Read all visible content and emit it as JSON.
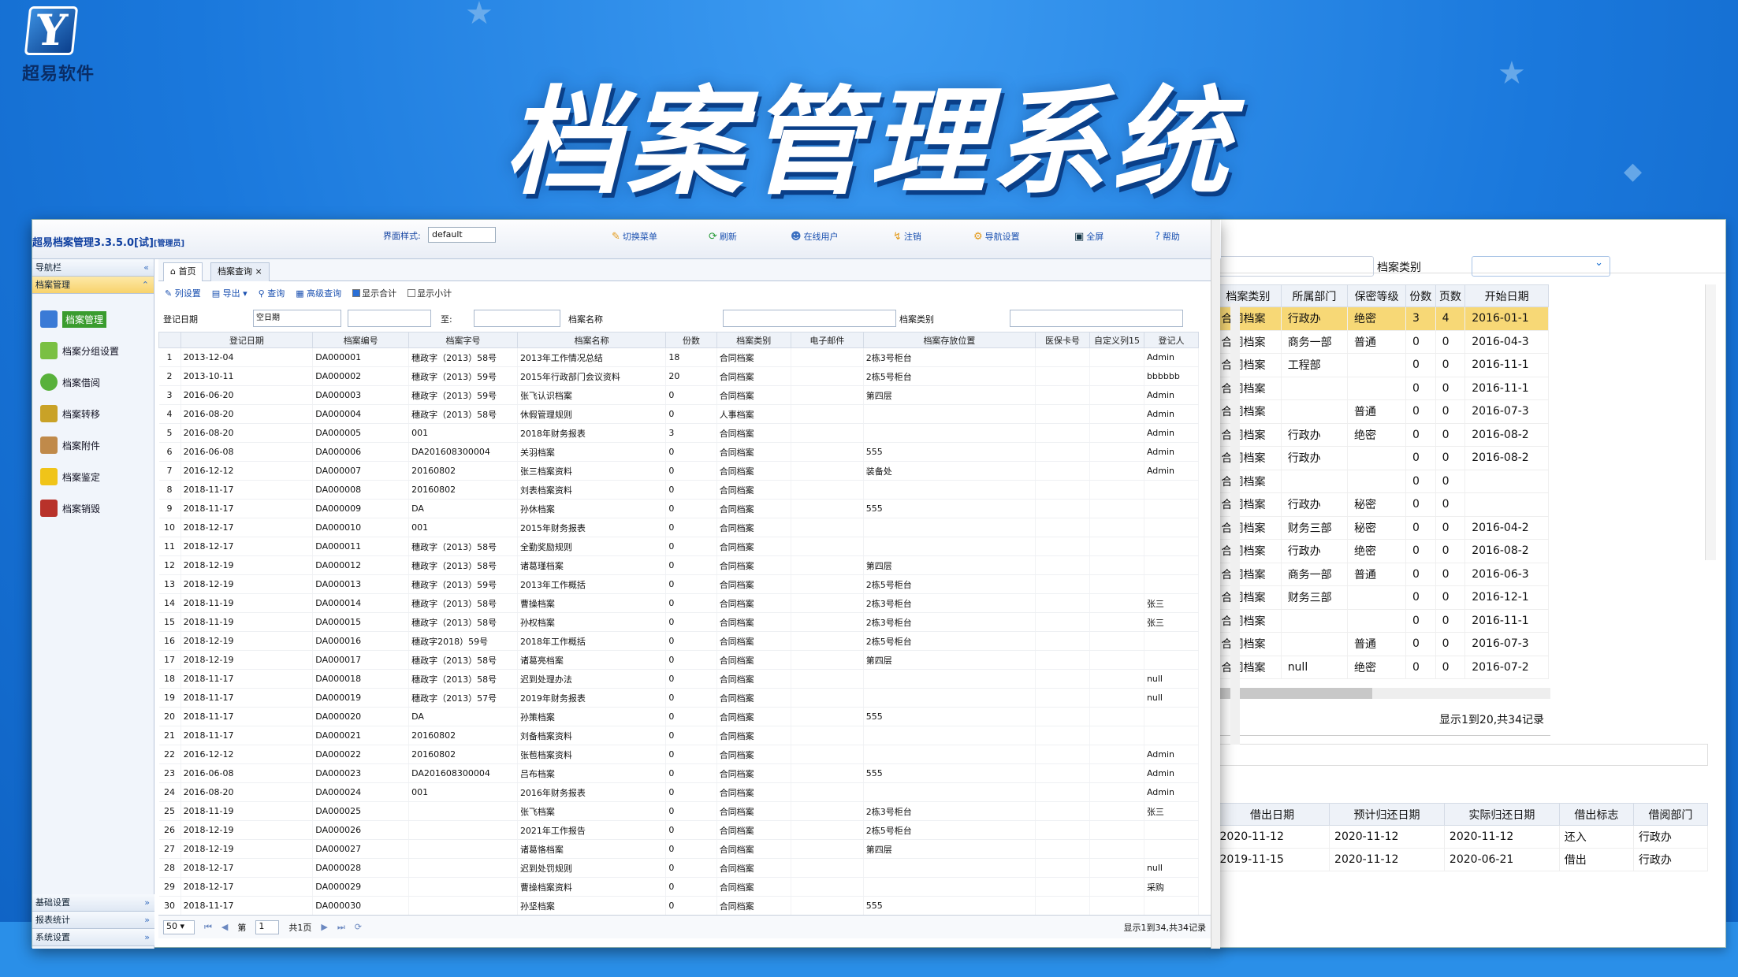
{
  "logo": {
    "mark": "Y",
    "text": "超易软件"
  },
  "banner": {
    "title": "档案管理系统"
  },
  "app": {
    "title": "超易档案管理3.3.5.0[试]",
    "role": "[管理员]",
    "theme_label": "界面样式:",
    "theme_value": "default",
    "topnav": [
      "切换菜单",
      "刷新",
      "在线用户",
      "注销",
      "导航设置",
      "全屏",
      "帮助"
    ]
  },
  "sidebar": {
    "nav_label": "导航栏",
    "section": "档案管理",
    "items": [
      "档案管理",
      "档案分组设置",
      "档案借阅",
      "档案转移",
      "档案附件",
      "档案鉴定",
      "档案销毁"
    ],
    "bottom": [
      "基础设置",
      "报表统计",
      "系统设置"
    ]
  },
  "tabs": [
    "首页",
    "档案查询"
  ],
  "toolbar": {
    "items": [
      "列设置",
      "导出",
      "查询",
      "高级查询"
    ],
    "show_total": "显示合计",
    "show_subtotal": "显示小计"
  },
  "query": {
    "date_label": "登记日期",
    "date_value": "空日期",
    "to_label": "至:",
    "name_label": "档案名称",
    "type_label": "档案类别"
  },
  "grid": {
    "headers": [
      "登记日期",
      "档案编号",
      "档案字号",
      "档案名称",
      "份数",
      "档案类别",
      "电子邮件",
      "档案存放位置",
      "医保卡号",
      "自定义列15",
      "登记人"
    ],
    "rows": [
      [
        "1",
        "2013-12-04",
        "DA000001",
        "穗政字（2013）58号",
        "2013年工作情况总结",
        "18",
        "合同档案",
        "",
        "2栋3号柜台",
        "",
        "",
        "Admin"
      ],
      [
        "2",
        "2013-10-11",
        "DA000002",
        "穗政字（2013）59号",
        "2015年行政部门会议资料",
        "20",
        "合同档案",
        "",
        "2栋5号柜台",
        "",
        "",
        "bbbbbb"
      ],
      [
        "3",
        "2016-06-20",
        "DA000003",
        "穗政字（2013）59号",
        "张飞认识档案",
        "0",
        "合同档案",
        "",
        "第四层",
        "",
        "",
        "Admin"
      ],
      [
        "4",
        "2016-08-20",
        "DA000004",
        "穗政字（2013）58号",
        "休假管理规则",
        "0",
        "人事档案",
        "",
        "",
        "",
        "",
        "Admin"
      ],
      [
        "5",
        "2016-08-20",
        "DA000005",
        "001",
        "2018年财务报表",
        "3",
        "合同档案",
        "",
        "",
        "",
        "",
        "Admin"
      ],
      [
        "6",
        "2016-06-08",
        "DA000006",
        "DA201608300004",
        "关羽档案",
        "0",
        "合同档案",
        "",
        "555",
        "",
        "",
        "Admin"
      ],
      [
        "7",
        "2016-12-12",
        "DA000007",
        "20160802",
        "张三档案资料",
        "0",
        "合同档案",
        "",
        "装备处",
        "",
        "",
        "Admin"
      ],
      [
        "8",
        "2018-11-17",
        "DA000008",
        "20160802",
        "刘表档案资料",
        "0",
        "合同档案",
        "",
        "",
        "",
        "",
        ""
      ],
      [
        "9",
        "2018-11-17",
        "DA000009",
        "DA",
        "孙休档案",
        "0",
        "合同档案",
        "",
        "555",
        "",
        "",
        ""
      ],
      [
        "10",
        "2018-12-17",
        "DA000010",
        "001",
        "2015年财务报表",
        "0",
        "合同档案",
        "",
        "",
        "",
        "",
        ""
      ],
      [
        "11",
        "2018-12-17",
        "DA000011",
        "穗政字（2013）58号",
        "全勤奖励规则",
        "0",
        "合同档案",
        "",
        "",
        "",
        "",
        ""
      ],
      [
        "12",
        "2018-12-19",
        "DA000012",
        "穗政字（2013）58号",
        "诸葛瑾档案",
        "0",
        "合同档案",
        "",
        "第四层",
        "",
        "",
        ""
      ],
      [
        "13",
        "2018-12-19",
        "DA000013",
        "穗政字（2013）59号",
        "2013年工作概括",
        "0",
        "合同档案",
        "",
        "2栋5号柜台",
        "",
        "",
        ""
      ],
      [
        "14",
        "2018-11-19",
        "DA000014",
        "穗政字（2013）58号",
        "曹操档案",
        "0",
        "合同档案",
        "",
        "2栋3号柜台",
        "",
        "",
        "张三"
      ],
      [
        "15",
        "2018-11-19",
        "DA000015",
        "穗政字（2013）58号",
        "孙权档案",
        "0",
        "合同档案",
        "",
        "2栋3号柜台",
        "",
        "",
        "张三"
      ],
      [
        "16",
        "2018-12-19",
        "DA000016",
        "穗政字2018）59号",
        "2018年工作概括",
        "0",
        "合同档案",
        "",
        "2栋5号柜台",
        "",
        "",
        ""
      ],
      [
        "17",
        "2018-12-19",
        "DA000017",
        "穗政字（2013）58号",
        "诸葛亮档案",
        "0",
        "合同档案",
        "",
        "第四层",
        "",
        "",
        ""
      ],
      [
        "18",
        "2018-11-17",
        "DA000018",
        "穗政字（2013）58号",
        "迟到处理办法",
        "0",
        "合同档案",
        "",
        "",
        "",
        "",
        "null"
      ],
      [
        "19",
        "2018-11-17",
        "DA000019",
        "穗政字（2013）57号",
        "2019年财务报表",
        "0",
        "合同档案",
        "",
        "",
        "",
        "",
        "null"
      ],
      [
        "20",
        "2018-11-17",
        "DA000020",
        "DA",
        "孙策档案",
        "0",
        "合同档案",
        "",
        "555",
        "",
        "",
        ""
      ],
      [
        "21",
        "2018-11-17",
        "DA000021",
        "20160802",
        "刘备档案资料",
        "0",
        "合同档案",
        "",
        "",
        "",
        "",
        ""
      ],
      [
        "22",
        "2016-12-12",
        "DA000022",
        "20160802",
        "张苞档案资料",
        "0",
        "合同档案",
        "",
        "",
        "",
        "",
        "Admin"
      ],
      [
        "23",
        "2016-06-08",
        "DA000023",
        "DA201608300004",
        "吕布档案",
        "0",
        "合同档案",
        "",
        "555",
        "",
        "",
        "Admin"
      ],
      [
        "24",
        "2016-08-20",
        "DA000024",
        "001",
        "2016年财务报表",
        "0",
        "合同档案",
        "",
        "",
        "",
        "",
        "Admin"
      ],
      [
        "25",
        "2018-11-19",
        "DA000025",
        "",
        "张飞档案",
        "0",
        "合同档案",
        "",
        "2栋3号柜台",
        "",
        "",
        "张三"
      ],
      [
        "26",
        "2018-12-19",
        "DA000026",
        "",
        "2021年工作报告",
        "0",
        "合同档案",
        "",
        "2栋5号柜台",
        "",
        "",
        ""
      ],
      [
        "27",
        "2018-12-19",
        "DA000027",
        "",
        "诸葛恪档案",
        "0",
        "合同档案",
        "",
        "第四层",
        "",
        "",
        ""
      ],
      [
        "28",
        "2018-12-17",
        "DA000028",
        "",
        "迟到处罚规则",
        "0",
        "合同档案",
        "",
        "",
        "",
        "",
        "null"
      ],
      [
        "29",
        "2018-12-17",
        "DA000029",
        "",
        "曹操档案资料",
        "0",
        "合同档案",
        "",
        "",
        "",
        "",
        "采购"
      ],
      [
        "30",
        "2018-11-17",
        "DA000030",
        "",
        "孙坚档案",
        "0",
        "合同档案",
        "",
        "555",
        "",
        "",
        ""
      ]
    ]
  },
  "pager": {
    "size": "50",
    "page_label": "第",
    "page": "1",
    "total_pages": "共1页",
    "summary": "显示1到34,共34记录"
  },
  "right_panel": {
    "filter_label": "档案类别",
    "headers": [
      "档案类别",
      "所属部门",
      "保密等级",
      "份数",
      "页数",
      "开始日期"
    ],
    "rows": [
      [
        "合同档案",
        "行政办",
        "绝密",
        "3",
        "4",
        "2016-01-1"
      ],
      [
        "合同档案",
        "商务一部",
        "普通",
        "0",
        "0",
        "2016-04-3"
      ],
      [
        "合同档案",
        "工程部",
        "",
        "0",
        "0",
        "2016-11-1"
      ],
      [
        "合同档案",
        "",
        "",
        "0",
        "0",
        "2016-11-1"
      ],
      [
        "合同档案",
        "",
        "普通",
        "0",
        "0",
        "2016-07-3"
      ],
      [
        "合同档案",
        "行政办",
        "绝密",
        "0",
        "0",
        "2016-08-2"
      ],
      [
        "合同档案",
        "行政办",
        "",
        "0",
        "0",
        "2016-08-2"
      ],
      [
        "合同档案",
        "",
        "",
        "0",
        "0",
        ""
      ],
      [
        "合同档案",
        "行政办",
        "秘密",
        "0",
        "0",
        ""
      ],
      [
        "合同档案",
        "财务三部",
        "秘密",
        "0",
        "0",
        "2016-04-2"
      ],
      [
        "合同档案",
        "行政办",
        "绝密",
        "0",
        "0",
        "2016-08-2"
      ],
      [
        "合同档案",
        "商务一部",
        "普通",
        "0",
        "0",
        "2016-06-3"
      ],
      [
        "合同档案",
        "财务三部",
        "",
        "0",
        "0",
        "2016-12-1"
      ],
      [
        "合同档案",
        "",
        "",
        "0",
        "0",
        "2016-11-1"
      ],
      [
        "合同档案",
        "",
        "普通",
        "0",
        "0",
        "2016-07-3"
      ],
      [
        "合同档案",
        "null",
        "绝密",
        "0",
        "0",
        "2016-07-2"
      ]
    ],
    "summary": "显示1到20,共34记录",
    "borrow_headers": [
      "借出日期",
      "预计归还日期",
      "实际归还日期",
      "借出标志",
      "借阅部门"
    ],
    "borrow_rows": [
      [
        "2020-11-12",
        "2020-11-12",
        "2020-11-12",
        "还入",
        "行政办"
      ],
      [
        "2019-11-15",
        "2020-11-12",
        "2020-06-21",
        "借出",
        "行政办"
      ]
    ]
  },
  "colors": {
    "accent": "#1a7fe0",
    "highlight": "#f7d876",
    "selected": "#3a9c2e"
  }
}
